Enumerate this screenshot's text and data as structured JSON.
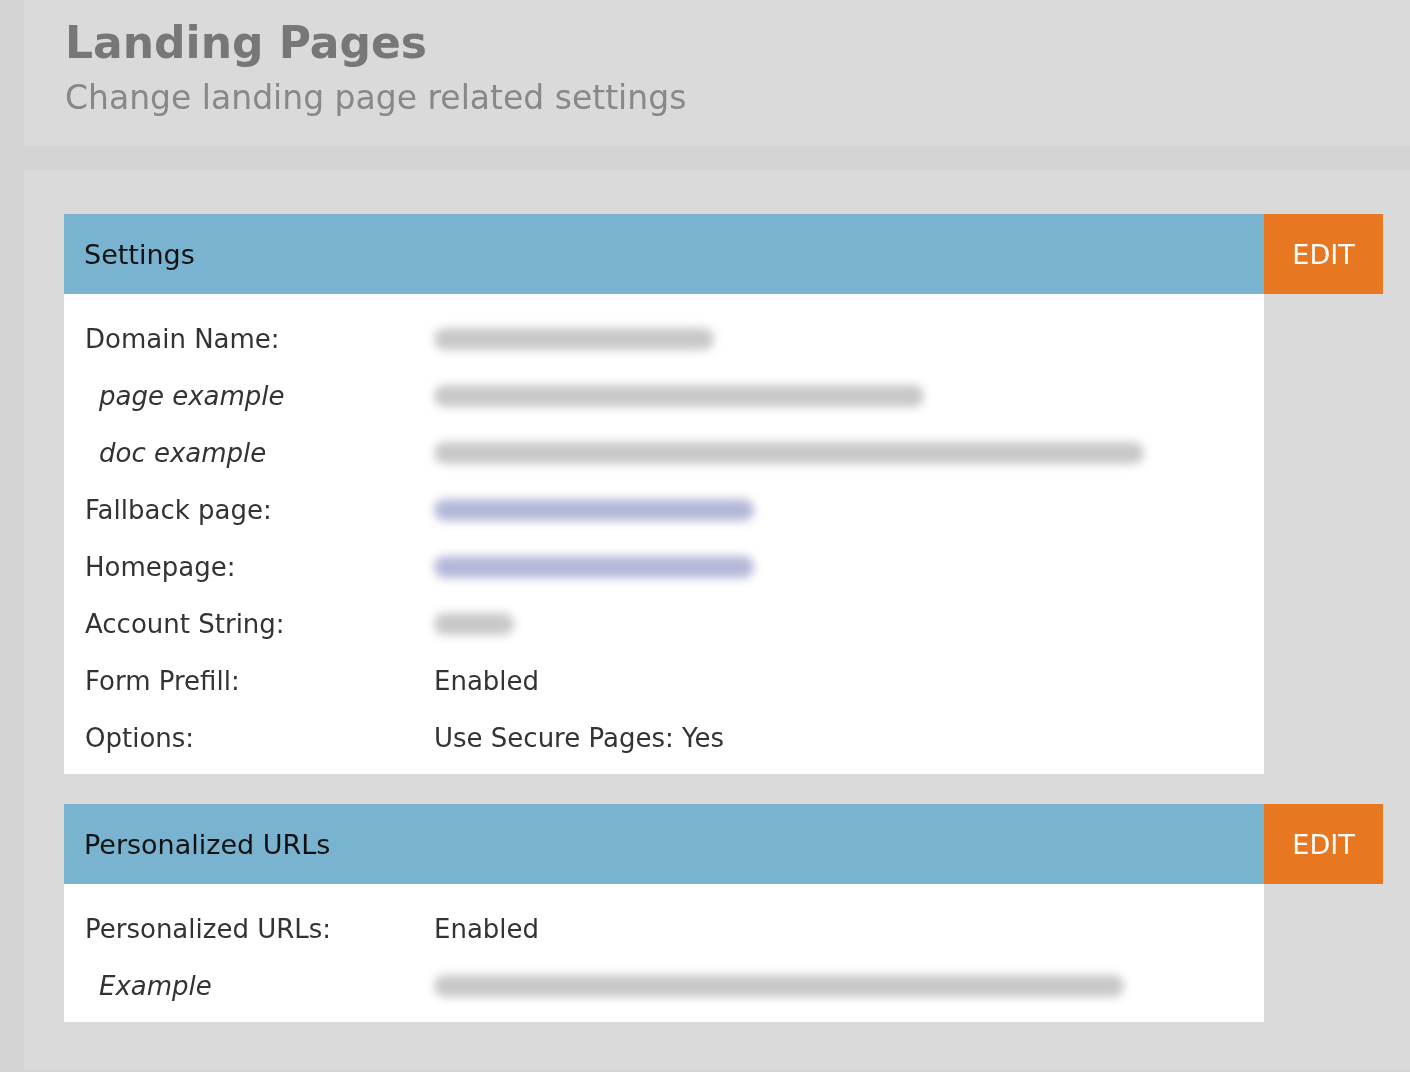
{
  "header": {
    "title": "Landing Pages",
    "subtitle": "Change landing page related settings"
  },
  "sections": [
    {
      "title": "Settings",
      "button": "EDIT",
      "rows": [
        {
          "label": "Domain Name:",
          "kind": "redacted",
          "sub": false
        },
        {
          "label": "page example",
          "kind": "redacted",
          "sub": true
        },
        {
          "label": "doc example",
          "kind": "redacted",
          "sub": true
        },
        {
          "label": "Fallback page:",
          "kind": "redacted_link",
          "sub": false
        },
        {
          "label": "Homepage:",
          "kind": "redacted_link",
          "sub": false
        },
        {
          "label": "Account String:",
          "kind": "redacted",
          "sub": false
        },
        {
          "label": "Form Prefill:",
          "kind": "text",
          "value": "Enabled",
          "sub": false
        },
        {
          "label": "Options:",
          "kind": "text",
          "value": "Use Secure Pages: Yes",
          "sub": false
        }
      ]
    },
    {
      "title": "Personalized URLs",
      "button": "EDIT",
      "rows": [
        {
          "label": "Personalized URLs:",
          "kind": "text",
          "value": "Enabled",
          "sub": false
        },
        {
          "label": "Example",
          "kind": "redacted",
          "sub": true
        }
      ]
    }
  ]
}
